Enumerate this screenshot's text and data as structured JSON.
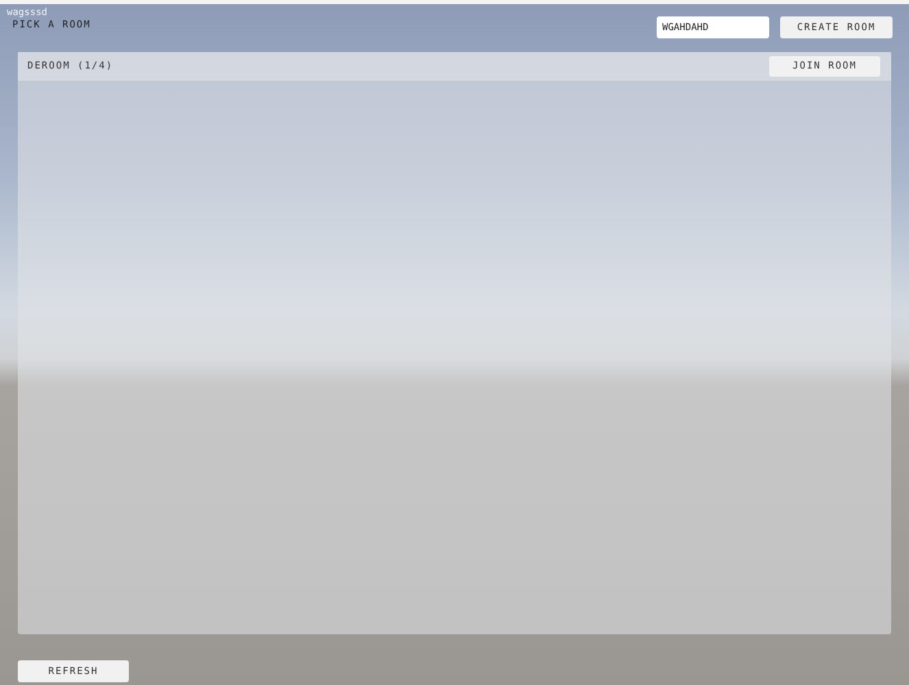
{
  "player_name": "wagsssd",
  "title": "PICK A ROOM",
  "room_name_field": {
    "value": "WGAHDAHD"
  },
  "create_button": "CREATE ROOM",
  "rooms": [
    {
      "label": "DEROOM (1/4)",
      "join": "JOIN ROOM"
    }
  ],
  "refresh_button": "REFRESH"
}
